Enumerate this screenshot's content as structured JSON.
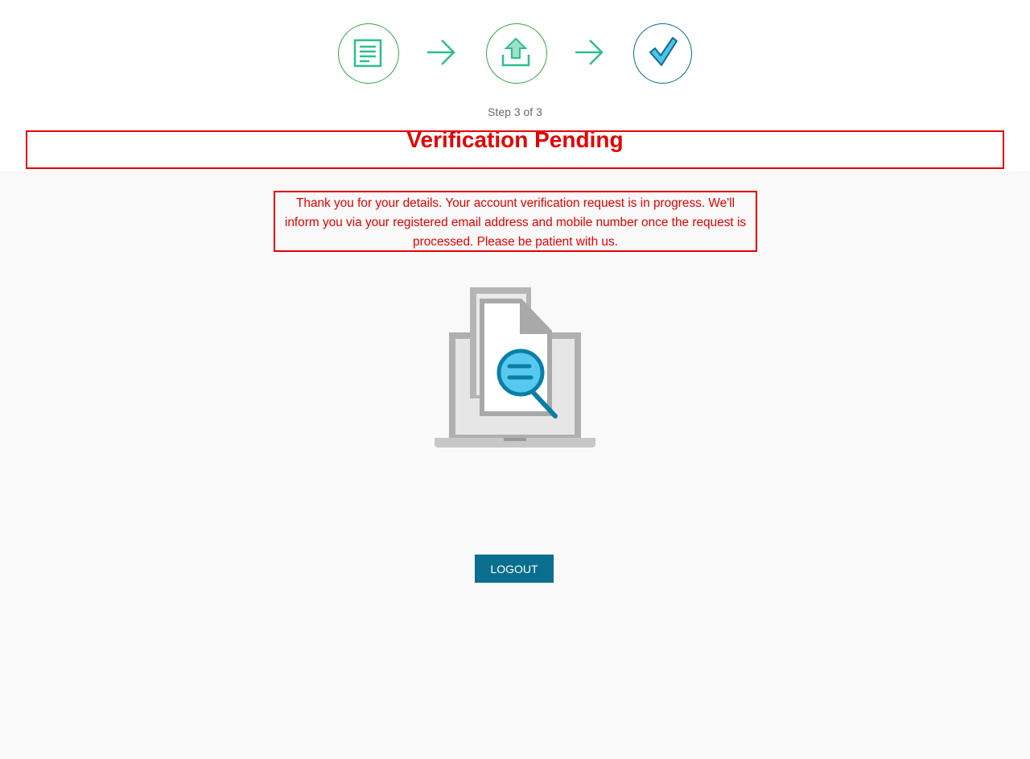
{
  "stepper": {
    "steps": [
      {
        "icon": "document-list-icon",
        "status": "complete"
      },
      {
        "icon": "upload-icon",
        "status": "complete"
      },
      {
        "icon": "checkmark-icon",
        "status": "current"
      }
    ],
    "step_text": "Step 3 of 3"
  },
  "title": "Verification Pending",
  "message": "Thank you for your details. Your account verification request is in progress. We'll inform you via your registered email address and mobile number once the request is processed. Please be patient with us.",
  "illustration": {
    "icon": "document-verification-laptop-icon"
  },
  "logout_label": "LOGOUT",
  "colors": {
    "accent_green": "#2bbf8e",
    "circle_border_green": "#3aa54a",
    "circle_border_blue": "#0a6e8e",
    "alert_red": "#e50000",
    "button_blue": "#0a6e8e"
  }
}
